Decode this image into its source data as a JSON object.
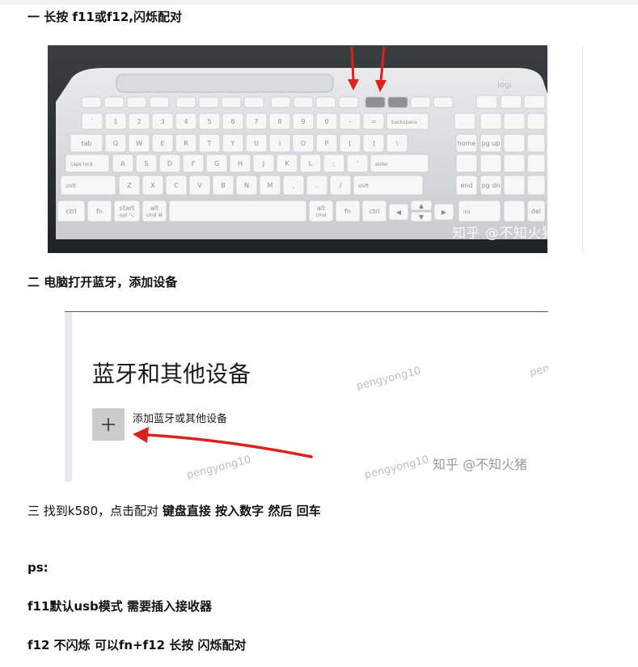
{
  "steps": {
    "s1": {
      "prefix": "一",
      "text": "长按 f11或f12,闪烁配对"
    },
    "s2": {
      "prefix": "二",
      "text": "电脑打开蓝牙，添加设备"
    },
    "s3": {
      "prefix": "三",
      "text_plain": "找到k580，点击配对",
      "text_bold": "键盘直接 按入数字 然后 回车"
    }
  },
  "ps": {
    "title": "ps:",
    "line1": "f11默认usb模式 需要插入接收器",
    "line2": "f12 不闪烁 可以fn+f12 长按 闪烁配对"
  },
  "keyboard_photo": {
    "brand": "logi",
    "watermark": "知乎 @不知火猪",
    "arrow_color": "#e0201a",
    "keys": {
      "backspace": "backspace",
      "tab": "tab",
      "caps": "caps lock",
      "enter": "enter",
      "shift_left": "shift",
      "shift_right": "shift",
      "ctrl_left": "ctrl",
      "ctrl_right": "ctrl",
      "fn_left": "fn",
      "fn_right": "fn",
      "start": "start",
      "start_sub": "opt ⌥",
      "alt": "alt",
      "alt_sub": "cmd ⌘",
      "alt_r": "alt",
      "alt_r_sub": "cmd",
      "home": "home",
      "pgup": "pg up",
      "end": "end",
      "pgdn": "pg dn",
      "ins": "ins",
      "del": "del",
      "row_num": [
        "`",
        "1",
        "2",
        "3",
        "4",
        "5",
        "6",
        "7",
        "8",
        "9",
        "0",
        "-",
        "="
      ],
      "row_q": [
        "Q",
        "W",
        "E",
        "R",
        "T",
        "Y",
        "U",
        "I",
        "O",
        "P",
        "[",
        "]",
        "\\"
      ],
      "row_a": [
        "A",
        "S",
        "D",
        "F",
        "G",
        "H",
        "J",
        "K",
        "L",
        ";",
        "'"
      ],
      "row_z": [
        "Z",
        "X",
        "C",
        "V",
        "B",
        "N",
        "M",
        ",",
        ".",
        "/"
      ]
    }
  },
  "bt_screenshot": {
    "title": "蓝牙和其他设备",
    "add_label": "添加蓝牙或其他设备",
    "watermark_user": "pengyong10",
    "watermark_user_partial": "pen",
    "watermark_zhihu": "知乎 @不知火猪",
    "plus_icon": "+",
    "arrow_color": "#d9231c"
  }
}
